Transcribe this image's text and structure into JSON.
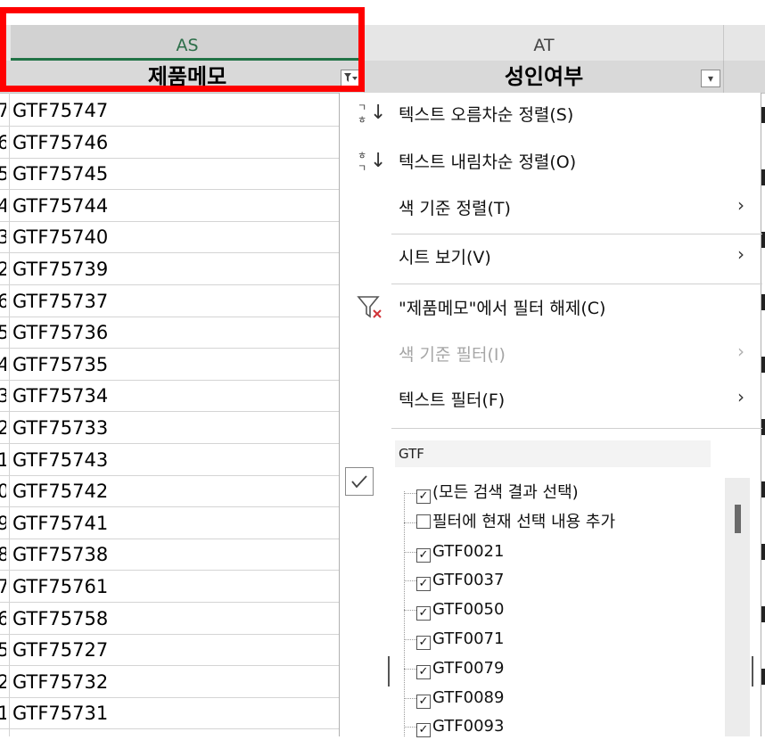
{
  "sheet": {
    "columns": [
      {
        "letter": "AS",
        "header": "제품메모"
      },
      {
        "letter": "AT",
        "header": "성인여부"
      }
    ],
    "filter_icon_active": "▾",
    "filter_icon_inactive": "▾",
    "rows": [
      {
        "idx": "7",
        "value": "GTF75747"
      },
      {
        "idx": "6",
        "value": "GTF75746"
      },
      {
        "idx": "5",
        "value": "GTF75745"
      },
      {
        "idx": "4",
        "value": "GTF75744"
      },
      {
        "idx": "3",
        "value": "GTF75740"
      },
      {
        "idx": "2",
        "value": "GTF75739"
      },
      {
        "idx": "6",
        "value": "GTF75737"
      },
      {
        "idx": "5",
        "value": "GTF75736"
      },
      {
        "idx": "4",
        "value": "GTF75735"
      },
      {
        "idx": "3",
        "value": "GTF75734"
      },
      {
        "idx": "2",
        "value": "GTF75733"
      },
      {
        "idx": "1",
        "value": "GTF75743"
      },
      {
        "idx": "0",
        "value": "GTF75742"
      },
      {
        "idx": "9",
        "value": "GTF75741"
      },
      {
        "idx": "8",
        "value": "GTF75738"
      },
      {
        "idx": "7",
        "value": "GTF75761"
      },
      {
        "idx": "6",
        "value": "GTF75758"
      },
      {
        "idx": "5",
        "value": "GTF75727"
      },
      {
        "idx": "2",
        "value": "GTF75732"
      },
      {
        "idx": "1",
        "value": "GTF75731"
      }
    ]
  },
  "menu": {
    "sort_asc": {
      "icon_top": "ㄱ",
      "icon_bottom": "ㅎ",
      "label": "텍스트 오름차순 정렬(S)"
    },
    "sort_desc": {
      "icon_top": "ㅎ",
      "icon_bottom": "ㄱ",
      "label": "텍스트 내림차순 정렬(O)"
    },
    "sort_by_color": {
      "label": "색 기준 정렬(T)"
    },
    "sheet_view": {
      "label": "시트 보기(V)"
    },
    "clear_filter": {
      "label": "\"제품메모\"에서 필터 해제(C)"
    },
    "filter_by_color": {
      "label": "색 기준 필터(I)"
    },
    "text_filter": {
      "label": "텍스트 필터(F)"
    },
    "chevron": "›",
    "search": {
      "value": "GTF"
    },
    "list": [
      {
        "label": "(모든 검색 결과 선택)",
        "checked": true
      },
      {
        "label": "필터에 현재 선택 내용 추가",
        "checked": false
      },
      {
        "label": "GTF0021",
        "checked": true
      },
      {
        "label": "GTF0037",
        "checked": true
      },
      {
        "label": "GTF0050",
        "checked": true
      },
      {
        "label": "GTF0071",
        "checked": true
      },
      {
        "label": "GTF0079",
        "checked": true
      },
      {
        "label": "GTF0089",
        "checked": true
      },
      {
        "label": "GTF0093",
        "checked": true
      }
    ]
  },
  "colors": {
    "highlight": "#ff0000",
    "selected_col": "#217346"
  }
}
